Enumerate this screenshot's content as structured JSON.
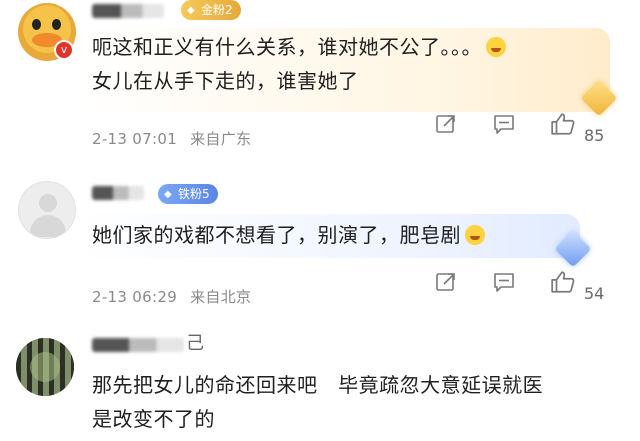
{
  "comments": [
    {
      "fan_badge": "金粉2",
      "text_line1": "呃这和正义有什么关系，谁对她不公了。。。",
      "text_line2": "女儿在从手下走的，谁害她了",
      "time": "2-13 07:01",
      "location": "来自广东",
      "likes": "85",
      "vip_mark": "v"
    },
    {
      "fan_badge": "铁粉5",
      "text": "她们家的戏都不想看了，别演了，肥皂剧",
      "time": "2-13 06:29",
      "location": "来自北京",
      "likes": "54"
    },
    {
      "name_tail": "己",
      "text_line1": "那先把女儿的命还回来吧   毕竟疏忽大意延误就医",
      "text_line2": "是改变不了的"
    }
  ],
  "icons": {
    "share": "share-icon",
    "comment": "comment-icon",
    "like": "like-icon"
  },
  "colors": {
    "gold_badge": "#e6a93a",
    "iron_badge": "#5a86e6",
    "meta_text": "#8a8a8a"
  }
}
